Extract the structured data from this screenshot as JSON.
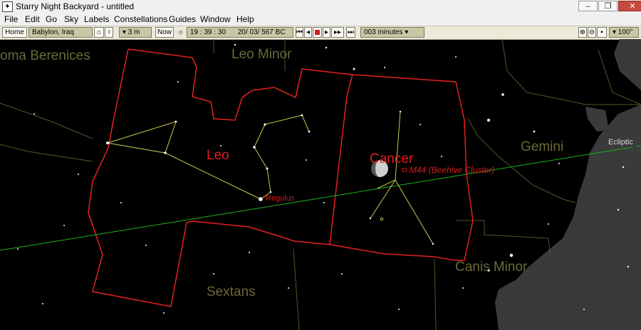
{
  "window": {
    "title": "Starry Night Backyard - untitled",
    "app_icon": "telescope-icon",
    "controls": [
      "minimize-icon",
      "maximize-icon",
      "close-icon"
    ]
  },
  "menu": [
    "File",
    "Edit",
    "Go",
    "Sky",
    "Labels",
    "Constellations",
    "Guides",
    "Window",
    "Help"
  ],
  "toolbar": {
    "home_label": "Home",
    "location": "Babylon, Iraq",
    "elevation": "▾ 3 m",
    "now_label": "Now",
    "time": "19 : 39 : 30",
    "date": "20/ 03/  567 BC",
    "time_step": "003 minutes ▾",
    "fov": "▾ 100°",
    "colors": {
      "field": "#cac7a5",
      "bar": "#ece9d8",
      "stop": "#cc2020"
    }
  },
  "sky": {
    "constellation_labels": {
      "coma": "oma Berenices",
      "leo_minor": "Leo Minor",
      "gemini": "Gemini",
      "canis_minor": "Canis Minor",
      "sextans": "Sextans",
      "leo": "Leo",
      "cancer": "Cancer"
    },
    "objects": {
      "regulus": "Regulus",
      "m44": "M44 (Beehive Cluster)"
    },
    "ecliptic_label": "Ecliptic",
    "colors": {
      "background": "#000000",
      "boundary_selected": "#e52020",
      "boundary_other": "#55552a",
      "stick_figure": "#c9c94c",
      "ecliptic": "#1db01d",
      "milky_way": "#3a3a3a"
    }
  }
}
